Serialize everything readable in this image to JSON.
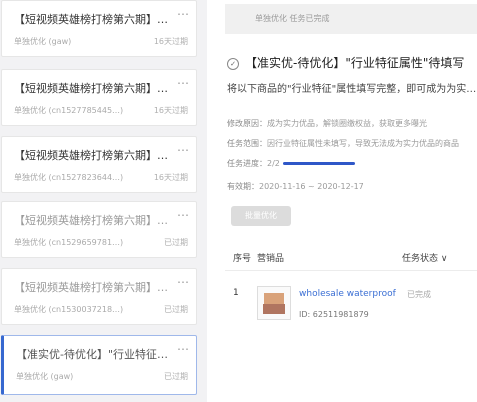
{
  "left_list": {
    "items": [
      {
        "title": "【短视频英雄榜打榜第六期】为曝光产…",
        "subtitle": "单独优化 (gaw)",
        "status": "16天过期"
      },
      {
        "title": "【短视频英雄榜打榜第六期】为曝光产…",
        "subtitle": "单独优化 (cn1527785445…)",
        "status": "16天过期"
      },
      {
        "title": "【短视频英雄榜打榜第六期】为曝光产…",
        "subtitle": "单独优化 (cn1527823644…)",
        "status": "16天过期"
      },
      {
        "title": "【短视频英雄榜打榜第六期】为曝光产…",
        "subtitle": "单独优化 (cn1529659781…)",
        "status": "已过期"
      },
      {
        "title": "【短视频英雄榜打榜第六期】为曝光产…",
        "subtitle": "单独优化 (cn1530037218…)",
        "status": "已过期"
      },
      {
        "title": "【准实优-待优化】\"行业特征属性\"待填…",
        "subtitle": "单独优化 (gaw)",
        "status": "已过期"
      }
    ],
    "more_icon": "⋯"
  },
  "detail": {
    "banner": "单独优化  任务已完成",
    "title": "【准实优-待优化】\"行业特征属性\"待填写",
    "description": "将以下商品的\"行业特征\"属性填写完整，即可成为为实力优品",
    "reason_label": "修改原因：",
    "reason_value": "成为实力优品，解锁圈缴权益，获取更多曝光",
    "scope_label": "任务范围：",
    "scope_value": "因行业特征属性未填写，导致无法成为实力优品的商品",
    "progress_label": "任务进度：",
    "progress_value": "2/2",
    "progress_ratio": 1.0,
    "period_label": "有效期：",
    "period_value": "2020-11-16 ~ 2020-12-17",
    "button_label": "批量优化",
    "accent_color": "#2f57c8"
  },
  "table": {
    "headers": {
      "no": "序号",
      "product": "营销品",
      "status": "任务状态 ∨"
    },
    "rows": [
      {
        "no": "1",
        "name": "wholesale waterproof kr...",
        "status": "已完成",
        "id": "ID: 62511981879"
      }
    ]
  }
}
